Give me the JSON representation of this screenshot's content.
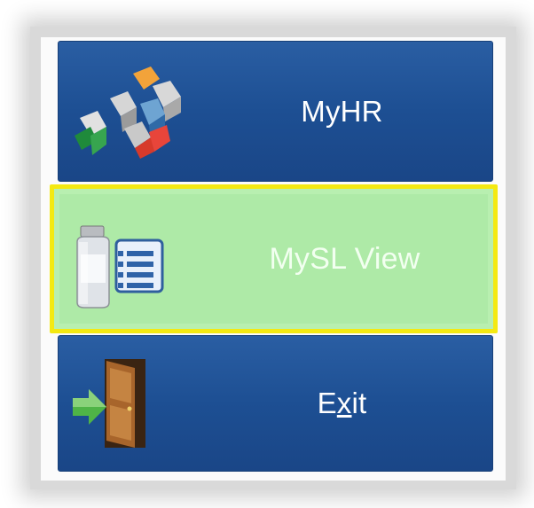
{
  "menu": {
    "items": [
      {
        "label": "MyHR",
        "icon": "myhr-cubes-icon"
      },
      {
        "label": "MySL View",
        "icon": "medicine-document-icon"
      },
      {
        "label_prefix": "E",
        "label_accel": "x",
        "label_suffix": "it",
        "icon": "exit-door-icon"
      }
    ]
  },
  "colors": {
    "item_blue": "#1d4f93",
    "selected_fill": "#b8efb0",
    "selected_border": "#f4e912",
    "label_text": "#ffffff"
  }
}
